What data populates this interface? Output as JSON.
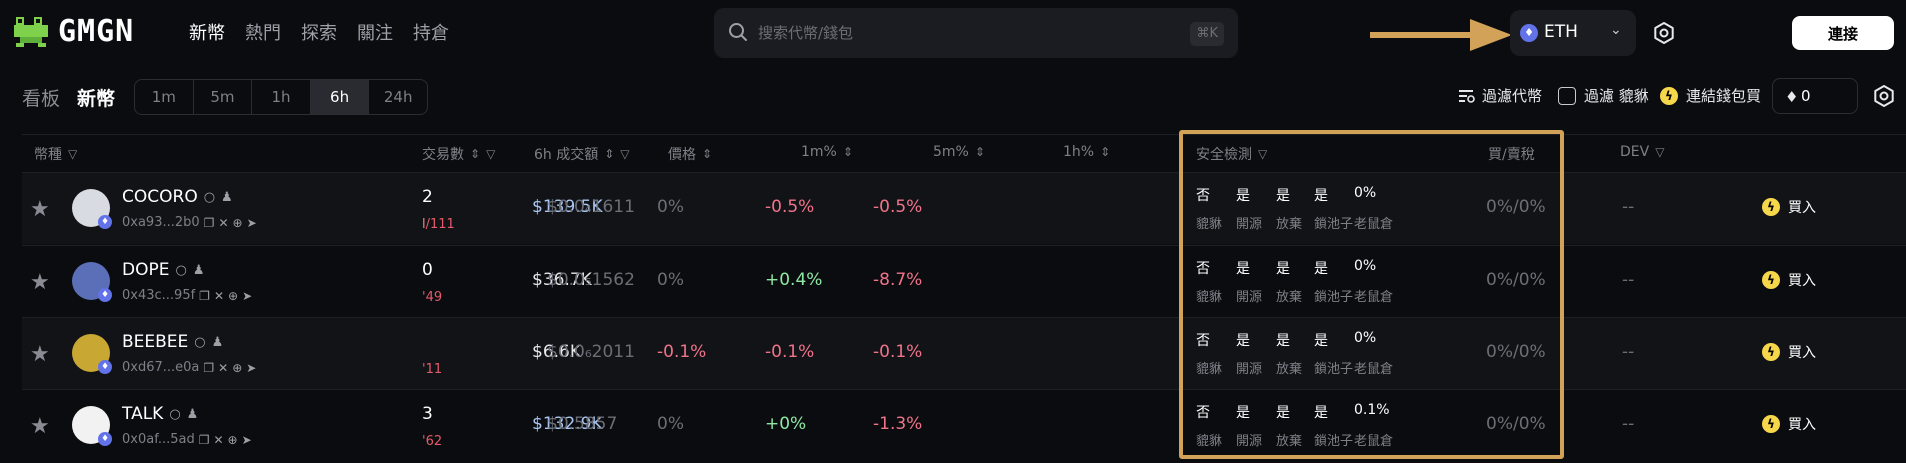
{
  "app": {
    "logo_text": "GMGN",
    "nav": [
      "新幣",
      "熱門",
      "探索",
      "關注",
      "持倉"
    ],
    "nav_active": 0
  },
  "search": {
    "placeholder": "搜索代幣/錢包",
    "shortcut": "⌘K"
  },
  "chain": {
    "label": "ETH",
    "icon": "ethereum-icon"
  },
  "connect_label": "連接",
  "subbar": {
    "board_label": "看板",
    "page_label": "新幣",
    "timeframes": [
      "1m",
      "5m",
      "1h",
      "6h",
      "24h"
    ],
    "timeframe_active": 3,
    "filter_tokens_label": "過濾代幣",
    "hide_honeypot_label": "過濾 貔貅",
    "link_wallet_label": "連結錢包買",
    "amount_value": "0"
  },
  "table": {
    "headers": {
      "token": "幣種",
      "txns": "交易數",
      "volume": "6h 成交額",
      "price": "價格",
      "m1": "1m%",
      "m5": "5m%",
      "h1": "1h%",
      "security": "安全檢測",
      "tax": "買/賣稅",
      "dev": "DEV"
    },
    "security_labels": [
      "貔貅",
      "開源",
      "放棄",
      "鎖池子",
      "老鼠倉"
    ],
    "buy_label": "買入",
    "rows": [
      {
        "name": "COCORO",
        "address": "0xa93...2b0",
        "txns": "2",
        "txns_buy": "l",
        "txns_sell": "/111",
        "volume": "$139.5K",
        "volume_highlight": true,
        "price": "$0.0₄1611",
        "m1": "0%",
        "m1_tone": "neutral",
        "m5": "-0.5%",
        "m5_tone": "neg",
        "h1": "-0.5%",
        "h1_tone": "neg",
        "security": [
          "否",
          "是",
          "是",
          "是",
          "0%"
        ],
        "tax": "0%/0%",
        "dev": "--",
        "avatar_bg": "#d9dbe3"
      },
      {
        "name": "DOPE",
        "address": "0x43c...95f",
        "txns": "0",
        "txns_buy": "",
        "txns_sell": "'49",
        "volume": "$36.7K",
        "volume_highlight": false,
        "price": "$0.0₅1562",
        "m1": "0%",
        "m1_tone": "neutral",
        "m5": "+0.4%",
        "m5_tone": "pos",
        "h1": "-8.7%",
        "h1_tone": "neg",
        "security": [
          "否",
          "是",
          "是",
          "是",
          "0%"
        ],
        "tax": "0%/0%",
        "dev": "--",
        "avatar_bg": "#5b6fb8"
      },
      {
        "name": "BEEBEE",
        "address": "0xd67...e0a",
        "txns": "",
        "txns_buy": "",
        "txns_sell": "'11",
        "volume": "$6.6K",
        "volume_highlight": false,
        "price": "$0.0₆2011",
        "m1": "-0.1%",
        "m1_tone": "neg",
        "m5": "-0.1%",
        "m5_tone": "neg",
        "h1": "-0.1%",
        "h1_tone": "neg",
        "security": [
          "否",
          "是",
          "是",
          "是",
          "0%"
        ],
        "tax": "0%/0%",
        "dev": "--",
        "avatar_bg": "#c8a832"
      },
      {
        "name": "TALK",
        "address": "0x0af...5ad",
        "txns": "3",
        "txns_buy": "",
        "txns_sell": "'62",
        "volume": "$132.9K",
        "volume_highlight": true,
        "price": "$0.5857",
        "m1": "0%",
        "m1_tone": "neutral",
        "m5": "+0%",
        "m5_tone": "pos",
        "h1": "-1.3%",
        "h1_tone": "neg",
        "security": [
          "否",
          "是",
          "是",
          "是",
          "0.1%"
        ],
        "tax": "0%/0%",
        "dev": "--",
        "avatar_bg": "#f2f2f2"
      }
    ]
  },
  "colors": {
    "background": "#0b0c0f",
    "highlight_box": "#d1a258",
    "positive": "#8ee8a4",
    "negative": "#f0738a",
    "volume_highlight": "#a9c7f5"
  }
}
